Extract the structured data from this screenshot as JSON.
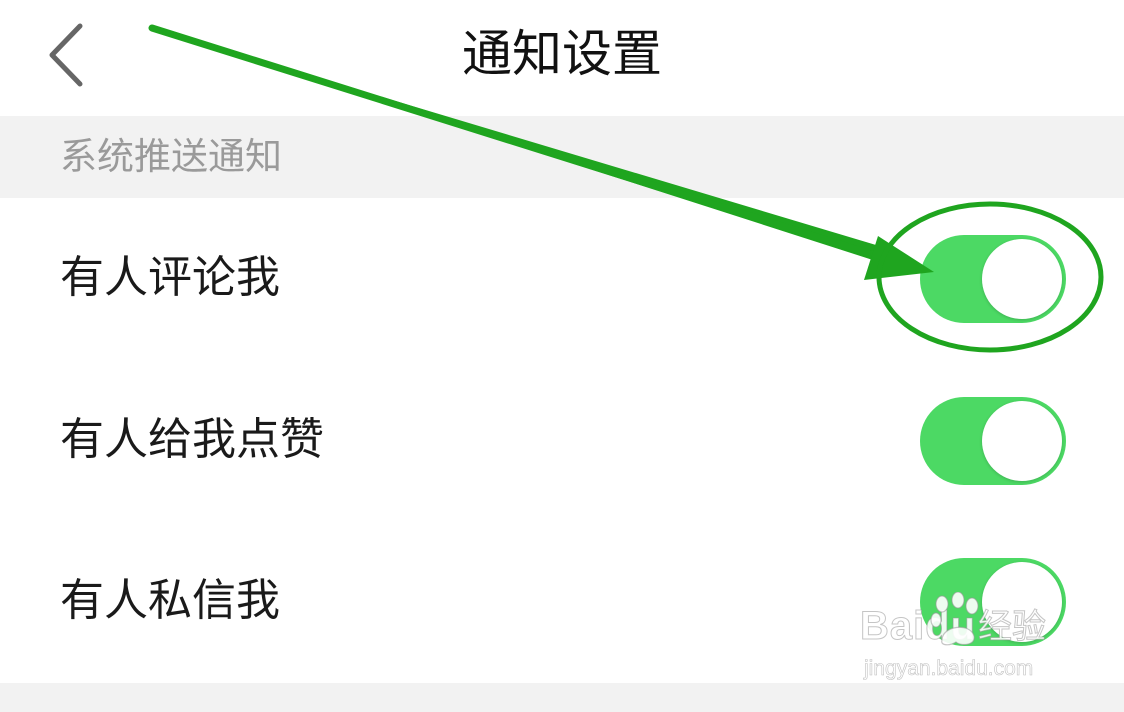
{
  "header": {
    "title": "通知设置",
    "back_icon": "chevron-left-icon"
  },
  "section": {
    "title": "系统推送通知"
  },
  "settings": [
    {
      "label": "有人评论我",
      "enabled": true
    },
    {
      "label": "有人给我点赞",
      "enabled": true
    },
    {
      "label": "有人私信我",
      "enabled": true
    }
  ],
  "colors": {
    "toggle_on": "#4cd964",
    "annotation": "#1fa51f",
    "section_bg": "#f2f2f2"
  },
  "watermark": {
    "brand": "Baidu",
    "brand_cn": "经验",
    "url": "jingyan.baidu.com"
  }
}
